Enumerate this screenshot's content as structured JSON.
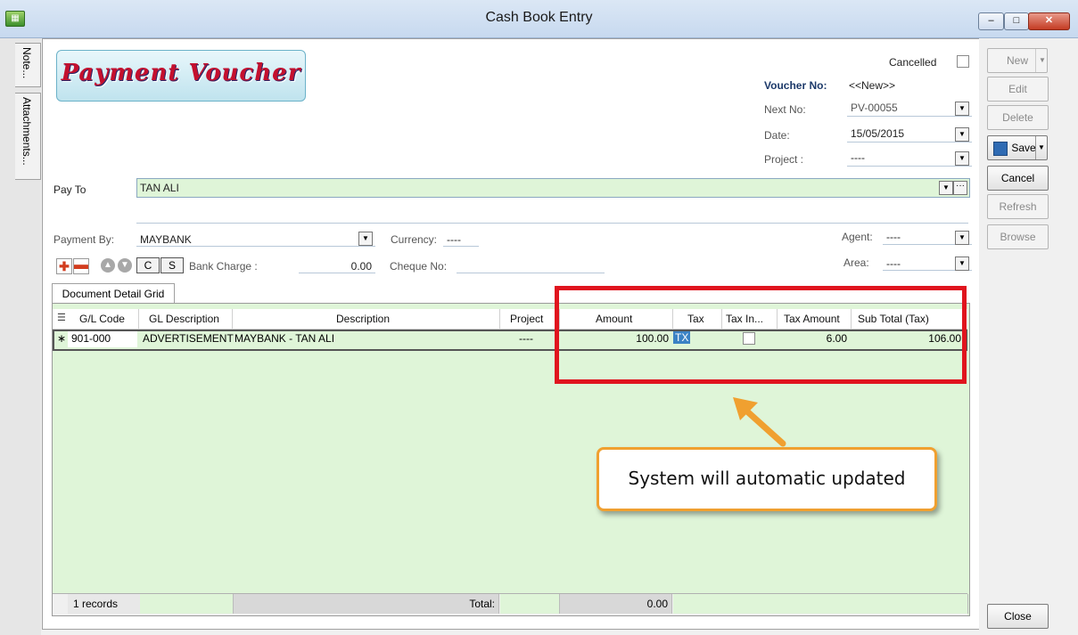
{
  "window": {
    "title": "Cash Book Entry",
    "close_glyph": "✕",
    "min_glyph": "–",
    "max_glyph": "□"
  },
  "left_tabs": [
    "Note...",
    "Attachments..."
  ],
  "logo": {
    "text": "Payment Voucher"
  },
  "header": {
    "cancelled_label": "Cancelled",
    "voucher_no_label": "Voucher No:",
    "voucher_no_value": "<<New>>",
    "next_no_label": "Next No:",
    "next_no_value": "PV-00055",
    "date_label": "Date:",
    "date_value": "15/05/2015",
    "project_label": "Project :",
    "project_value": "----"
  },
  "pay_to": {
    "label": "Pay To",
    "value": "TAN ALI",
    "more": "···"
  },
  "payment": {
    "by_label": "Payment By:",
    "by_value": "MAYBANK",
    "currency_label": "Currency:",
    "currency_value": "----",
    "agent_label": "Agent:",
    "agent_value": "----",
    "area_label": "Area:",
    "area_value": "----",
    "bank_charge_label": "Bank Charge :",
    "bank_charge_value": "0.00",
    "cheque_no_label": "Cheque No:",
    "btn_c": "C",
    "btn_s": "S"
  },
  "actions": {
    "new": "New",
    "edit": "Edit",
    "delete": "Delete",
    "save": "Save",
    "cancel": "Cancel",
    "refresh": "Refresh",
    "browse": "Browse",
    "close": "Close"
  },
  "grid": {
    "tab_label": "Document Detail Grid",
    "columns": [
      "G/L Code",
      "GL Description",
      "Description",
      "Project",
      "Amount",
      "Tax",
      "Tax In...",
      "Tax Amount",
      "Sub Total (Tax)"
    ],
    "row": {
      "marker": "∗",
      "gl_code": "901-000",
      "gl_description": "ADVERTISEMENT",
      "description": "MAYBANK - TAN ALI",
      "project": "----",
      "amount": "100.00",
      "tax": "TX",
      "tax_amount": "6.00",
      "sub_total": "106.00"
    },
    "footer": {
      "records": "1 records",
      "total_label": "Total:",
      "total_value": "0.00"
    }
  },
  "annotation": {
    "callout": "System will automatic updated",
    "accent": "#e0141e",
    "callout_border": "#f0a030"
  }
}
